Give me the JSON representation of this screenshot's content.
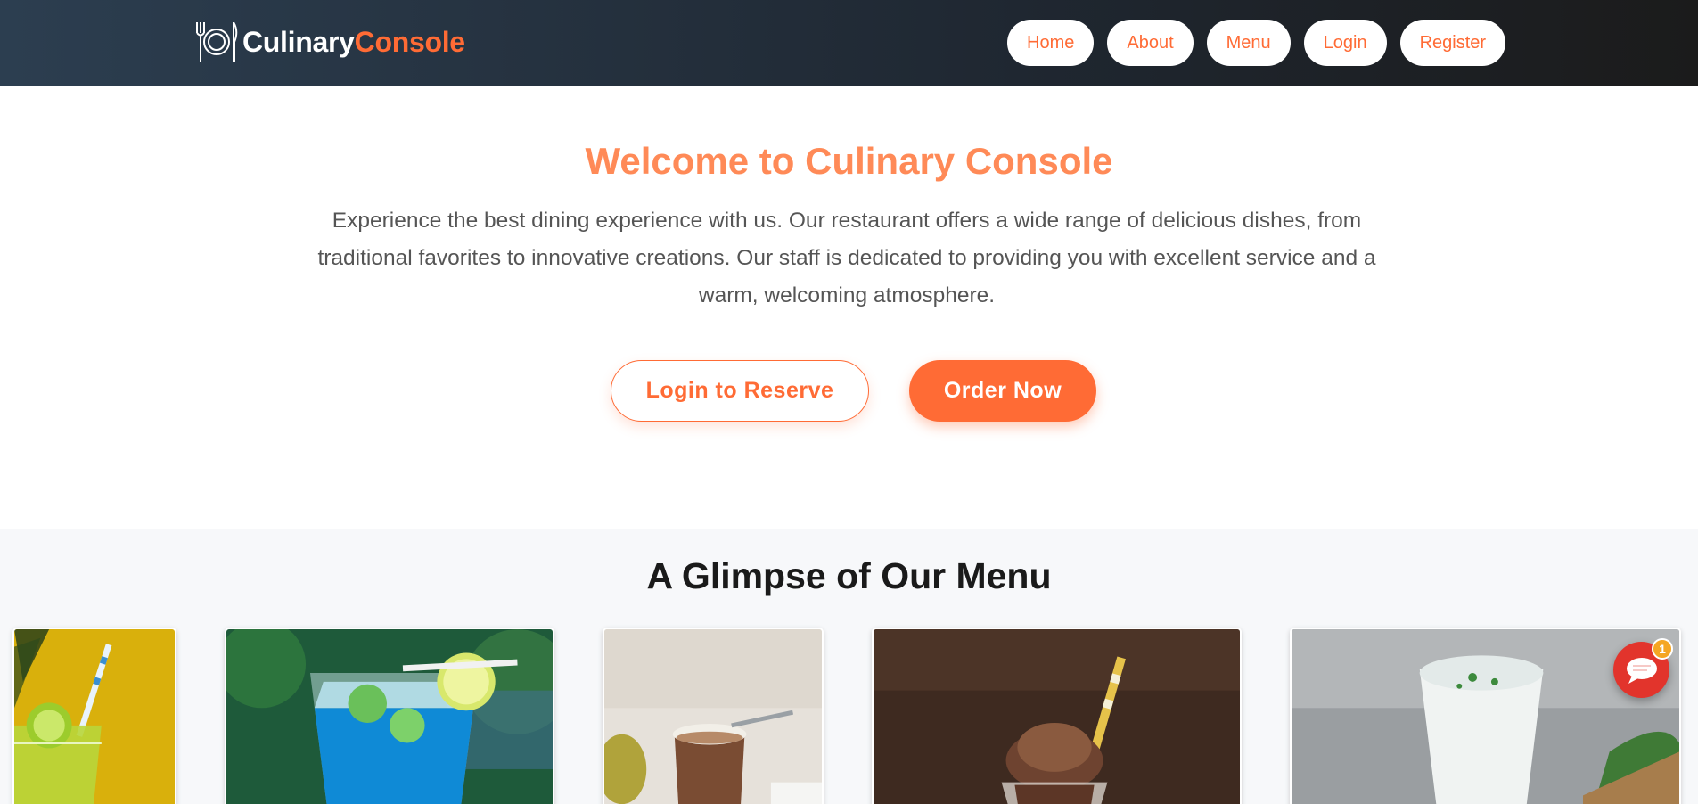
{
  "brand": {
    "part1": "Culinary",
    "part2": "Console",
    "logo_icon": "plate-fork-knife-icon"
  },
  "nav": {
    "home": "Home",
    "about": "About",
    "menu": "Menu",
    "login": "Login",
    "register": "Register"
  },
  "hero": {
    "title": "Welcome to Culinary Console",
    "text": "Experience the best dining experience with us. Our restaurant offers a wide range of delicious dishes, from traditional favorites to innovative creations. Our staff is dedicated to providing you with excellent service and a warm, welcoming atmosphere.",
    "login_btn": "Login to Reserve",
    "order_btn": "Order Now"
  },
  "glimpse": {
    "title": "A Glimpse of Our Menu",
    "cards": [
      "lime-drink-image",
      "blue-lagoon-image",
      "chocolate-shake-image",
      "chocolate-frappe-image",
      "lassi-image"
    ]
  },
  "chat": {
    "badge": "1",
    "icon": "chat-bubble-icon"
  },
  "colors": {
    "accent": "#ff6b35",
    "title": "#ff8a57",
    "header_dark": "#1f2731",
    "chat": "#e2342c"
  }
}
